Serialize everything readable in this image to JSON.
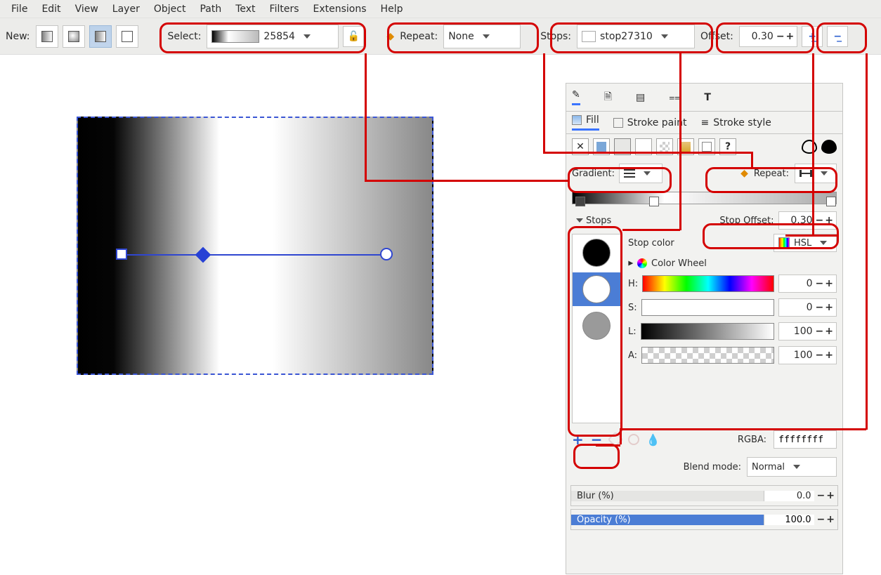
{
  "menubar": {
    "items": [
      "File",
      "Edit",
      "View",
      "Layer",
      "Object",
      "Path",
      "Text",
      "Filters",
      "Extensions",
      "Help"
    ]
  },
  "toolbar": {
    "new_label": "New:",
    "select_label": "Select:",
    "gradient_name": "25854",
    "repeat_label": "Repeat:",
    "repeat_value": "None",
    "stops_label": "Stops:",
    "stop_name": "stop27310",
    "offset_label": "Offset:",
    "offset_value": "0.30"
  },
  "panel": {
    "tabs_sub": {
      "fill": "Fill",
      "stroke_paint": "Stroke paint",
      "stroke_style": "Stroke style"
    },
    "gradient_label": "Gradient:",
    "repeat_label": "Repeat:",
    "stops_header": "Stops",
    "stop_offset_label": "Stop Offset:",
    "stop_offset_value": "0.30",
    "stop_color_label": "Stop color",
    "color_model": "HSL",
    "color_wheel_label": "Color Wheel",
    "hsl": {
      "H": {
        "label": "H:",
        "value": "0"
      },
      "S": {
        "label": "S:",
        "value": "0"
      },
      "L": {
        "label": "L:",
        "value": "100"
      },
      "A": {
        "label": "A:",
        "value": "100"
      }
    },
    "rgba_label": "RGBA:",
    "rgba_value": "ffffffff",
    "blend_label": "Blend mode:",
    "blend_value": "Normal",
    "blur_label": "Blur (%)",
    "blur_value": "0.0",
    "opacity_label": "Opacity (%)",
    "opacity_value": "100.0"
  }
}
